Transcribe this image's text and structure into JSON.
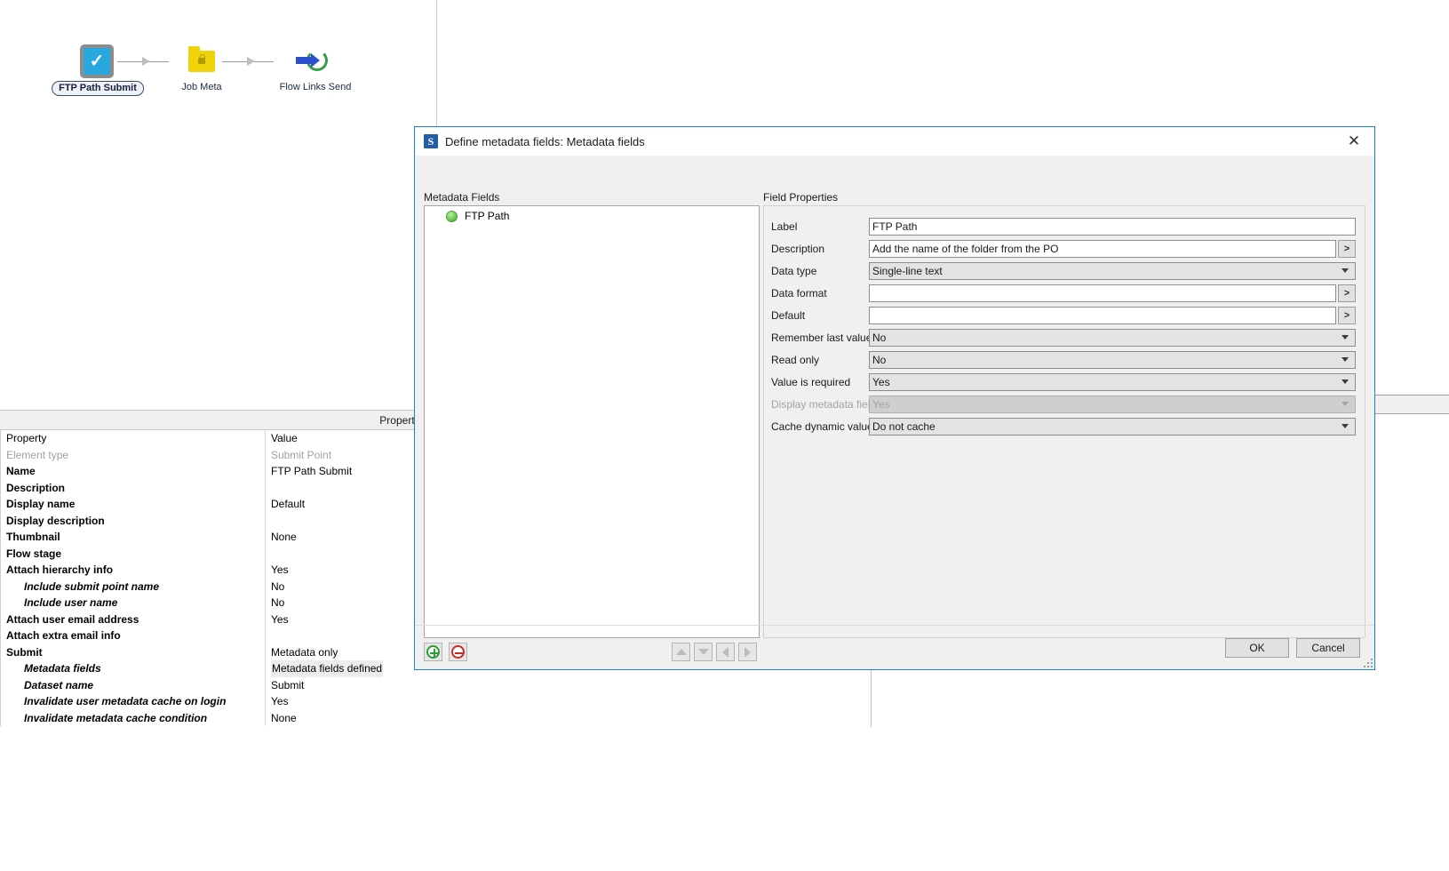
{
  "canvas": {
    "nodes": [
      {
        "label": "FTP Path Submit",
        "icon": "submit-point-icon"
      },
      {
        "label": "Job Meta",
        "icon": "folder-lock-icon"
      },
      {
        "label": "Flow Links Send",
        "icon": "flow-links-send-icon"
      }
    ]
  },
  "properties_panel": {
    "title": "Properties",
    "columns": {
      "property": "Property",
      "value": "Value"
    },
    "rows": [
      {
        "key": "Element type",
        "value": "Submit Point",
        "style": "dim"
      },
      {
        "key": "Name",
        "value": "FTP Path Submit",
        "style": "bold"
      },
      {
        "key": "Description",
        "value": "",
        "style": "bold"
      },
      {
        "key": "Display name",
        "value": "Default",
        "style": "bold"
      },
      {
        "key": "Display description",
        "value": "",
        "style": "bold"
      },
      {
        "key": "Thumbnail",
        "value": "None",
        "style": "bold"
      },
      {
        "key": "Flow stage",
        "value": "",
        "style": "bold"
      },
      {
        "key": "Attach hierarchy info",
        "value": "Yes",
        "style": "bold"
      },
      {
        "key": "Include submit point name",
        "value": "No",
        "style": "ital"
      },
      {
        "key": "Include user name",
        "value": "No",
        "style": "ital"
      },
      {
        "key": "Attach user email address",
        "value": "Yes",
        "style": "bold"
      },
      {
        "key": "Attach extra email info",
        "value": "",
        "style": "bold"
      },
      {
        "key": "Submit",
        "value": "Metadata only",
        "style": "bold"
      },
      {
        "key": "Metadata fields",
        "value": "Metadata fields defined",
        "style": "ital",
        "highlight": true
      },
      {
        "key": "Dataset name",
        "value": "Submit",
        "style": "ital"
      },
      {
        "key": "Invalidate user metadata cache on login",
        "value": "Yes",
        "style": "ital"
      },
      {
        "key": "Invalidate metadata cache condition",
        "value": "None",
        "style": "ital"
      }
    ]
  },
  "dialog": {
    "title": "Define metadata fields: Metadata fields",
    "app_icon_letter": "S",
    "close_label": "✕",
    "metadata_fields": {
      "section_label": "Metadata Fields",
      "items": [
        {
          "label": "FTP Path",
          "status": "green"
        }
      ],
      "toolbar": {
        "add_label": "+",
        "remove_label": "−",
        "move_up_label": "Move up",
        "move_down_label": "Move down",
        "move_left_label": "Outdent",
        "move_right_label": "Indent"
      }
    },
    "field_properties": {
      "section_label": "Field Properties",
      "rows": [
        {
          "label": "Label",
          "value": "FTP Path",
          "control": "text"
        },
        {
          "label": "Description",
          "value": "Add the name of the folder from the PO",
          "control": "text-browse",
          "browse_label": ">"
        },
        {
          "label": "Data type",
          "value": "Single-line text",
          "control": "combo"
        },
        {
          "label": "Data format",
          "value": "",
          "control": "text-browse",
          "browse_label": ">"
        },
        {
          "label": "Default",
          "value": "",
          "control": "text-browse",
          "browse_label": ">"
        },
        {
          "label": "Remember last value",
          "value": "No",
          "control": "combo"
        },
        {
          "label": "Read only",
          "value": "No",
          "control": "combo"
        },
        {
          "label": "Value is required",
          "value": "Yes",
          "control": "combo"
        },
        {
          "label": "Display metadata field",
          "value": "Yes",
          "control": "combo",
          "disabled": true
        },
        {
          "label": "Cache dynamic values",
          "value": "Do not cache",
          "control": "combo"
        }
      ]
    },
    "footer": {
      "ok_label": "OK",
      "cancel_label": "Cancel"
    }
  },
  "colors": {
    "dialog_border": "#1883d7",
    "node_submit": "#29a8e0",
    "node_folder": "#efd209",
    "node_ring": "#34a04a",
    "node_arrow": "#2d50d0",
    "bullet_green": "#63c748"
  }
}
